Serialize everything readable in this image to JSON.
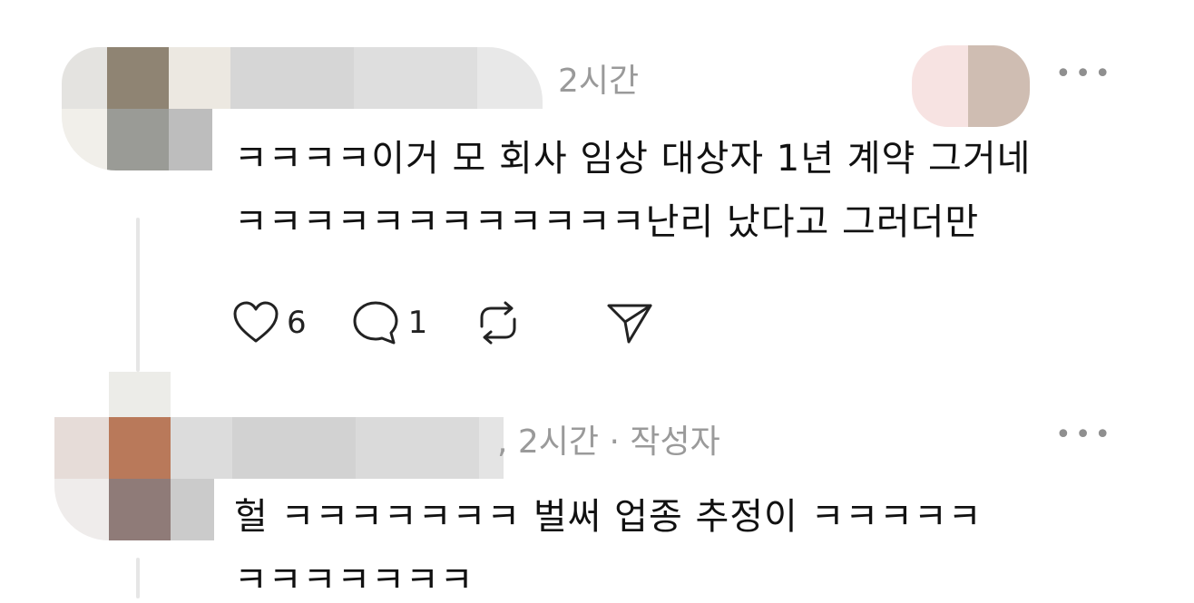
{
  "posts": [
    {
      "meta_text": "2시간",
      "more_label": "•••",
      "body_lines": [
        "ㅋㅋㅋㅋ이거 모 회사 임상 대상자 1년 계약 그거네",
        "ㅋㅋㅋㅋㅋㅋㅋㅋㅋㅋㅋㅋ난리 났다고 그러더만"
      ],
      "actions": {
        "like_icon": "heart-icon",
        "like_count": "6",
        "reply_icon": "speech-bubble-icon",
        "reply_count": "1",
        "repost_icon": "repost-icon",
        "share_icon": "send-icon"
      }
    },
    {
      "meta_text": ", 2시간 · 작성자",
      "more_label": "•••",
      "body_lines": [
        "헐 ㅋㅋㅋㅋㅋㅋㅋ 벌써 업종 추정이 ㅋㅋㅋㅋㅋ",
        "ㅋㅋㅋㅋㅋㅋㅋ"
      ]
    }
  ],
  "colors": {
    "text": "#111111",
    "meta": "#9a9a9a",
    "thread_line": "#e6e6e6"
  }
}
